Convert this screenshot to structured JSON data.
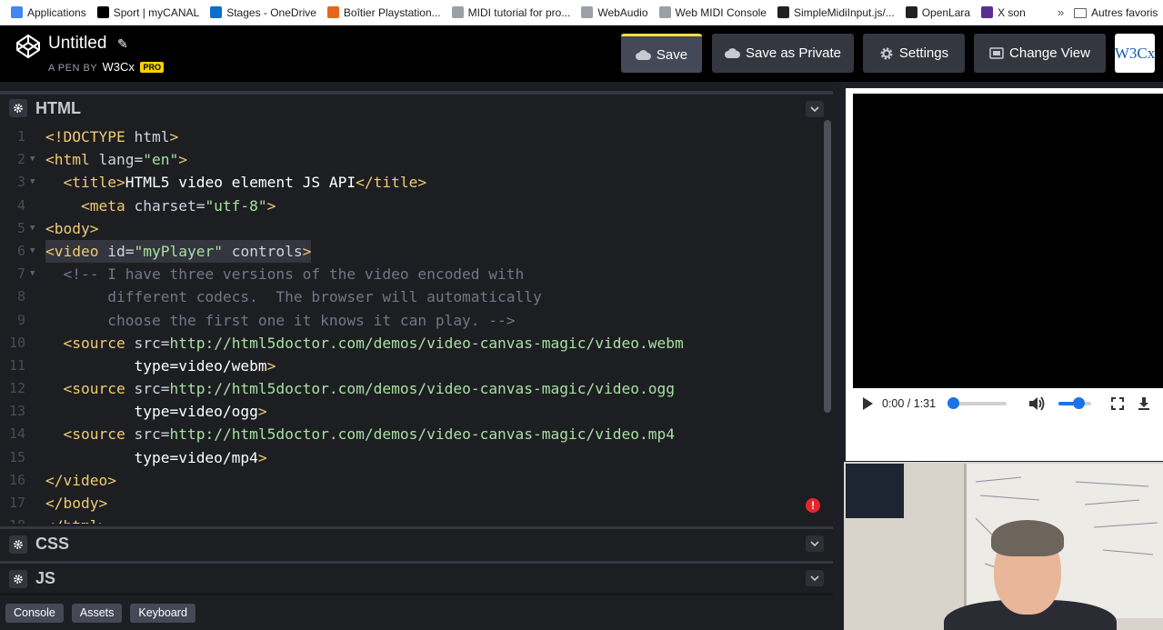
{
  "bookmarks": {
    "items": [
      {
        "label": "Applications",
        "color": "#4285f4"
      },
      {
        "label": "Sport | myCANAL",
        "color": "#000000"
      },
      {
        "label": "Stages - OneDrive",
        "color": "#0a6ecb"
      },
      {
        "label": "Boîtier Playstation...",
        "color": "#e8651c"
      },
      {
        "label": "MIDI tutorial for pro...",
        "color": "#9aa0a6"
      },
      {
        "label": "WebAudio",
        "color": "#9aa0a6"
      },
      {
        "label": "Web MIDI Console",
        "color": "#9aa0a6"
      },
      {
        "label": "SimpleMidiInput.js/...",
        "color": "#202124"
      },
      {
        "label": "OpenLara",
        "color": "#202124"
      },
      {
        "label": "X son",
        "color": "#5c2d91"
      }
    ],
    "more": "»",
    "other_folder": "Autres favoris"
  },
  "header": {
    "title": "Untitled",
    "byline_prefix": "A PEN BY",
    "author": "W3Cx",
    "badge": "PRO",
    "save": "Save",
    "save_private": "Save as Private",
    "settings": "Settings",
    "change_view": "Change View",
    "avatar_text": "W3Cx"
  },
  "panels": {
    "html": "HTML",
    "css": "CSS",
    "js": "JS",
    "error_badge": "!"
  },
  "bottom_bar": {
    "console": "Console",
    "assets": "Assets",
    "keyboard": "Keyboard"
  },
  "video": {
    "time": "0:00 / 1:31",
    "seek_fraction": 0.05,
    "volume_fraction": 0.6
  },
  "code_lines": [
    "<!DOCTYPE html>",
    "<html lang=\"en\">",
    "  <title>HTML5 video element JS API</title>",
    "    <meta charset=\"utf-8\">",
    "<body>",
    "<video id=\"myPlayer\" controls>",
    "  <!-- I have three versions of the video encoded with",
    "       different codecs.  The browser will automatically",
    "       choose the first one it knows it can play. -->",
    "  <source src=http://html5doctor.com/demos/video-canvas-magic/video.webm",
    "          type=video/webm>",
    "  <source src=http://html5doctor.com/demos/video-canvas-magic/video.ogg",
    "          type=video/ogg>",
    "  <source src=http://html5doctor.com/demos/video-canvas-magic/video.mp4",
    "          type=video/mp4>",
    "</video>",
    "</body>",
    "</html>"
  ],
  "colors": {
    "tag": "#f0ca72",
    "attr": "#d0d2dd",
    "value": "#a6e1a1",
    "comment": "#737686",
    "accent": "#ffdd40"
  }
}
